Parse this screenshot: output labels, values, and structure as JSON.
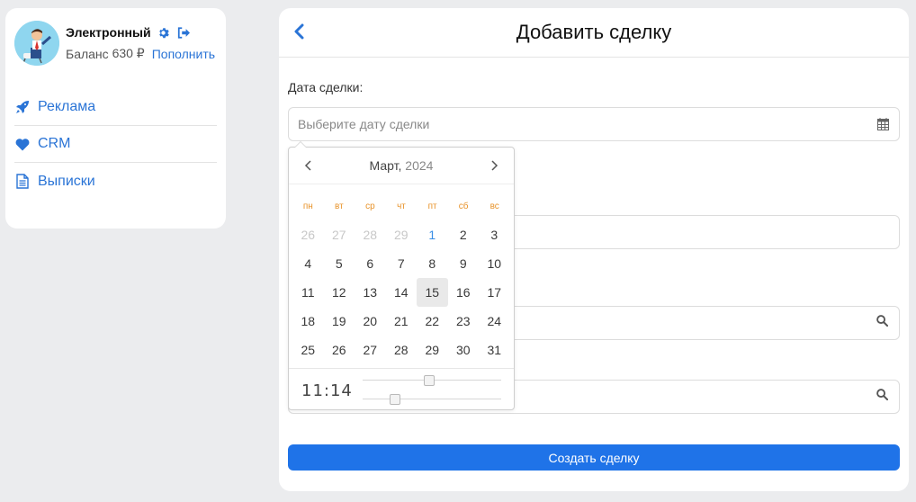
{
  "profile": {
    "name": "Электронный",
    "balance_label": "Баланс",
    "balance_value": "630 ₽",
    "topup_label": "Пополнить"
  },
  "menu": {
    "items": [
      {
        "label": "Реклама",
        "icon": "rocket-icon"
      },
      {
        "label": "CRM",
        "icon": "heart-icon"
      },
      {
        "label": "Выписки",
        "icon": "document-icon"
      }
    ]
  },
  "header": {
    "title": "Добавить сделку"
  },
  "form": {
    "date_label": "Дата сделки:",
    "date_placeholder": "Выберите дату сделки",
    "submit_label": "Создать сделку"
  },
  "picker": {
    "month": "Март",
    "year": "2024",
    "weekdays": [
      "пн",
      "вт",
      "ср",
      "чт",
      "пт",
      "сб",
      "вс"
    ],
    "days": [
      {
        "d": "26",
        "muted": true
      },
      {
        "d": "27",
        "muted": true
      },
      {
        "d": "28",
        "muted": true
      },
      {
        "d": "29",
        "muted": true
      },
      {
        "d": "1",
        "accent": true
      },
      {
        "d": "2"
      },
      {
        "d": "3"
      },
      {
        "d": "4"
      },
      {
        "d": "5"
      },
      {
        "d": "6"
      },
      {
        "d": "7"
      },
      {
        "d": "8"
      },
      {
        "d": "9"
      },
      {
        "d": "10"
      },
      {
        "d": "11"
      },
      {
        "d": "12"
      },
      {
        "d": "13"
      },
      {
        "d": "14"
      },
      {
        "d": "15",
        "selected": true
      },
      {
        "d": "16"
      },
      {
        "d": "17"
      },
      {
        "d": "18"
      },
      {
        "d": "19"
      },
      {
        "d": "20"
      },
      {
        "d": "21"
      },
      {
        "d": "22"
      },
      {
        "d": "23"
      },
      {
        "d": "24"
      },
      {
        "d": "25"
      },
      {
        "d": "26"
      },
      {
        "d": "27"
      },
      {
        "d": "28"
      },
      {
        "d": "29"
      },
      {
        "d": "30"
      },
      {
        "d": "31"
      }
    ],
    "time": "11:14",
    "hour_fraction": 0.478,
    "minute_fraction": 0.237
  },
  "colors": {
    "accent": "#2a74d6",
    "button": "#1f73e8",
    "weekday": "#e8932a"
  }
}
